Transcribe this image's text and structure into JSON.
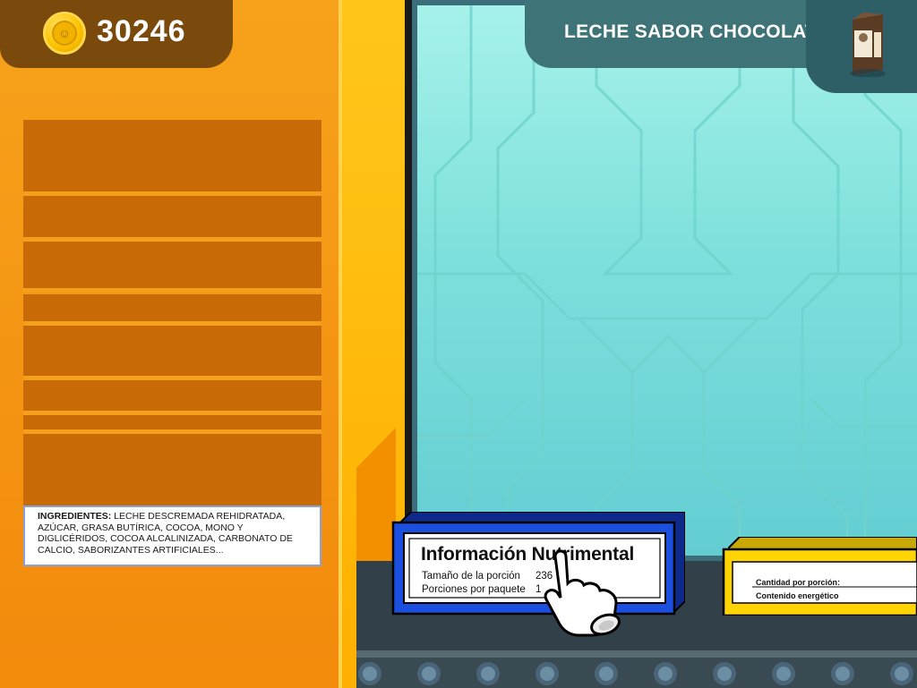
{
  "coins": {
    "value": "30246"
  },
  "product": {
    "title": "LECHE SABOR CHOCOLATE"
  },
  "ingredients": {
    "label": "INGREDIENTES:",
    "text": " LECHE DESCREMADA REHIDRATADA, AZÚCAR, GRASA BUTÍRICA, COCOA, MONO Y DIGLICÉRIDOS, COCOA ALCALINIZADA, CARBONATO DE CALCIO, SABORIZANTES ARTIFICIALES..."
  },
  "nutrition_label": {
    "title": "Información Nutrimental",
    "rows": [
      {
        "label": "Tamaño de la porción",
        "value": "236"
      },
      {
        "label": "Porciones por paquete",
        "value": "1"
      }
    ]
  },
  "yellow_label": {
    "rows": [
      {
        "label": "Cantidad por porción:"
      },
      {
        "label": "Contenido energético"
      }
    ]
  },
  "colors": {
    "left_panel": "#f39200",
    "screen": "#7ee0dc",
    "blue_box": "#1a4fe0",
    "yellow_box": "#ffd400",
    "title_bar": "#3e7378"
  }
}
